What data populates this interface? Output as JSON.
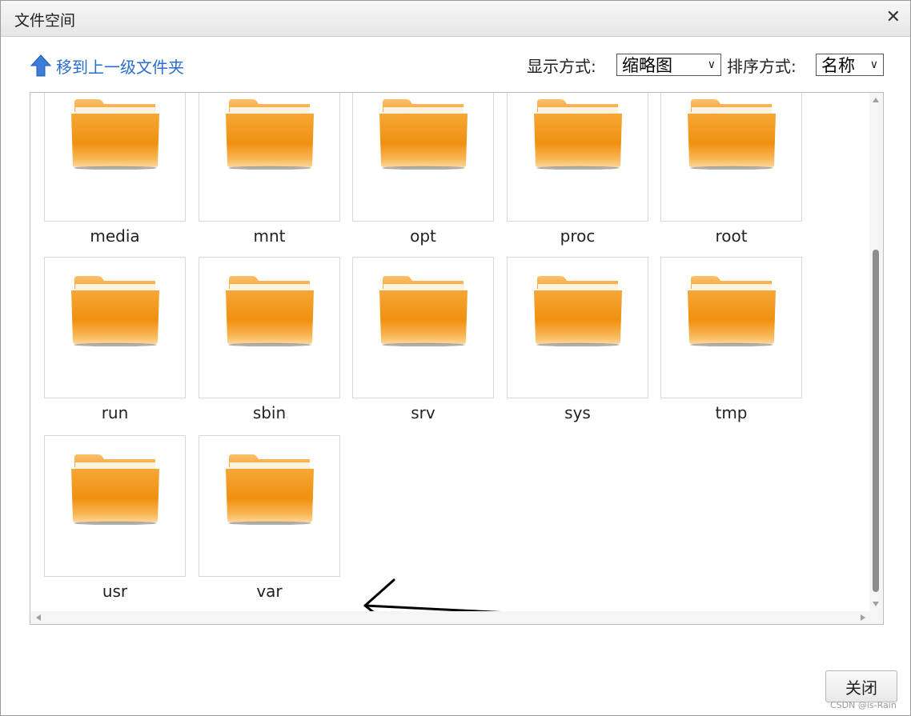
{
  "window": {
    "title": "文件空间",
    "close_icon": "close-icon"
  },
  "toolbar": {
    "up_label": "移到上一级文件夹",
    "display_label": "显示方式:",
    "display_value": "缩略图",
    "sort_label": "排序方式:",
    "sort_value": "名称"
  },
  "folders": [
    {
      "name": "media"
    },
    {
      "name": "mnt"
    },
    {
      "name": "opt"
    },
    {
      "name": "proc"
    },
    {
      "name": "root"
    },
    {
      "name": "run"
    },
    {
      "name": "sbin"
    },
    {
      "name": "srv"
    },
    {
      "name": "sys"
    },
    {
      "name": "tmp"
    },
    {
      "name": "usr"
    },
    {
      "name": "var"
    }
  ],
  "footer": {
    "close_label": "关闭"
  },
  "watermark": "CSDN @is-Rain",
  "colors": {
    "accent": "#2a6ed0",
    "folder": "#f39a1e",
    "folder_light": "#fbc46f"
  }
}
